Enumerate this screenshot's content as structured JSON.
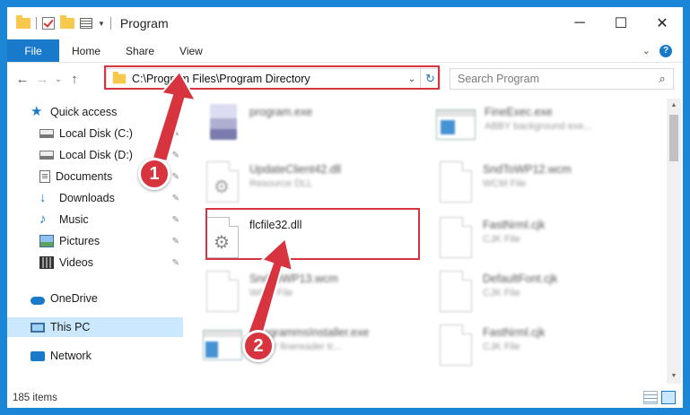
{
  "window": {
    "title": "Program",
    "controls": {
      "minimize": "─",
      "maximize": "☐",
      "close": "✕"
    }
  },
  "ribbon": {
    "tabs": [
      "File",
      "Home",
      "Share",
      "View"
    ],
    "expand_glyph": "⌄",
    "help_glyph": "?"
  },
  "nav": {
    "back": "←",
    "forward": "→",
    "recent": "⌄",
    "up": "↑",
    "address": "C:\\Program Files\\Program Directory",
    "address_dropdown": "⌄",
    "refresh": "↻",
    "search_placeholder": "Search Program"
  },
  "sidebar": {
    "items": [
      {
        "label": "Quick access",
        "icon": "star-icon",
        "pinned": false
      },
      {
        "label": "Local Disk (C:)",
        "icon": "disk-icon",
        "pinned": true
      },
      {
        "label": "Local Disk (D:)",
        "icon": "disk-icon",
        "pinned": true
      },
      {
        "label": "Documents",
        "icon": "documents-icon",
        "pinned": true
      },
      {
        "label": "Downloads",
        "icon": "download-icon",
        "pinned": true
      },
      {
        "label": "Music",
        "icon": "music-icon",
        "pinned": true
      },
      {
        "label": "Pictures",
        "icon": "pictures-icon",
        "pinned": true
      },
      {
        "label": "Videos",
        "icon": "videos-icon",
        "pinned": true
      },
      {
        "label": "OneDrive",
        "icon": "cloud-icon",
        "pinned": false
      },
      {
        "label": "This PC",
        "icon": "pc-icon",
        "pinned": false,
        "selected": true
      },
      {
        "label": "Network",
        "icon": "network-icon",
        "pinned": false
      }
    ],
    "pin_glyph": "📌"
  },
  "files": [
    {
      "name": "program.exe",
      "sub": "",
      "icon": "program-icon"
    },
    {
      "name": "FineExec.exe",
      "sub": "ABBY background exe...",
      "icon": "exe-icon"
    },
    {
      "name": "UpdateClient42.dll",
      "sub": "Resource DLL",
      "icon": "gear-file-icon"
    },
    {
      "name": "SndToWP12.wcm",
      "sub": "WCM File",
      "icon": "file-icon"
    },
    {
      "name": "flcfile32.dll",
      "sub": "",
      "icon": "gear-file-icon"
    },
    {
      "name": "FastNrml.cjk",
      "sub": "CJK File",
      "icon": "file-icon"
    },
    {
      "name": "SndToWP13.wcm",
      "sub": "WCM File",
      "icon": "file-icon"
    },
    {
      "name": "DefaultFont.cjk",
      "sub": "CJK File",
      "icon": "file-icon"
    },
    {
      "name": "ProgrammsInstaller.exe",
      "sub": "ABBY finereader tr...",
      "icon": "exe-icon"
    },
    {
      "name": "FastNrml.cjk",
      "sub": "CJK File",
      "icon": "file-icon"
    }
  ],
  "status": {
    "count": "185 items"
  },
  "annotations": {
    "callout_1": "1",
    "callout_2": "2",
    "highlight_color": "#d8343f"
  },
  "colors": {
    "accent": "#1979ca",
    "selected_bg": "#cce8ff",
    "desktop": "#1b86d6"
  }
}
